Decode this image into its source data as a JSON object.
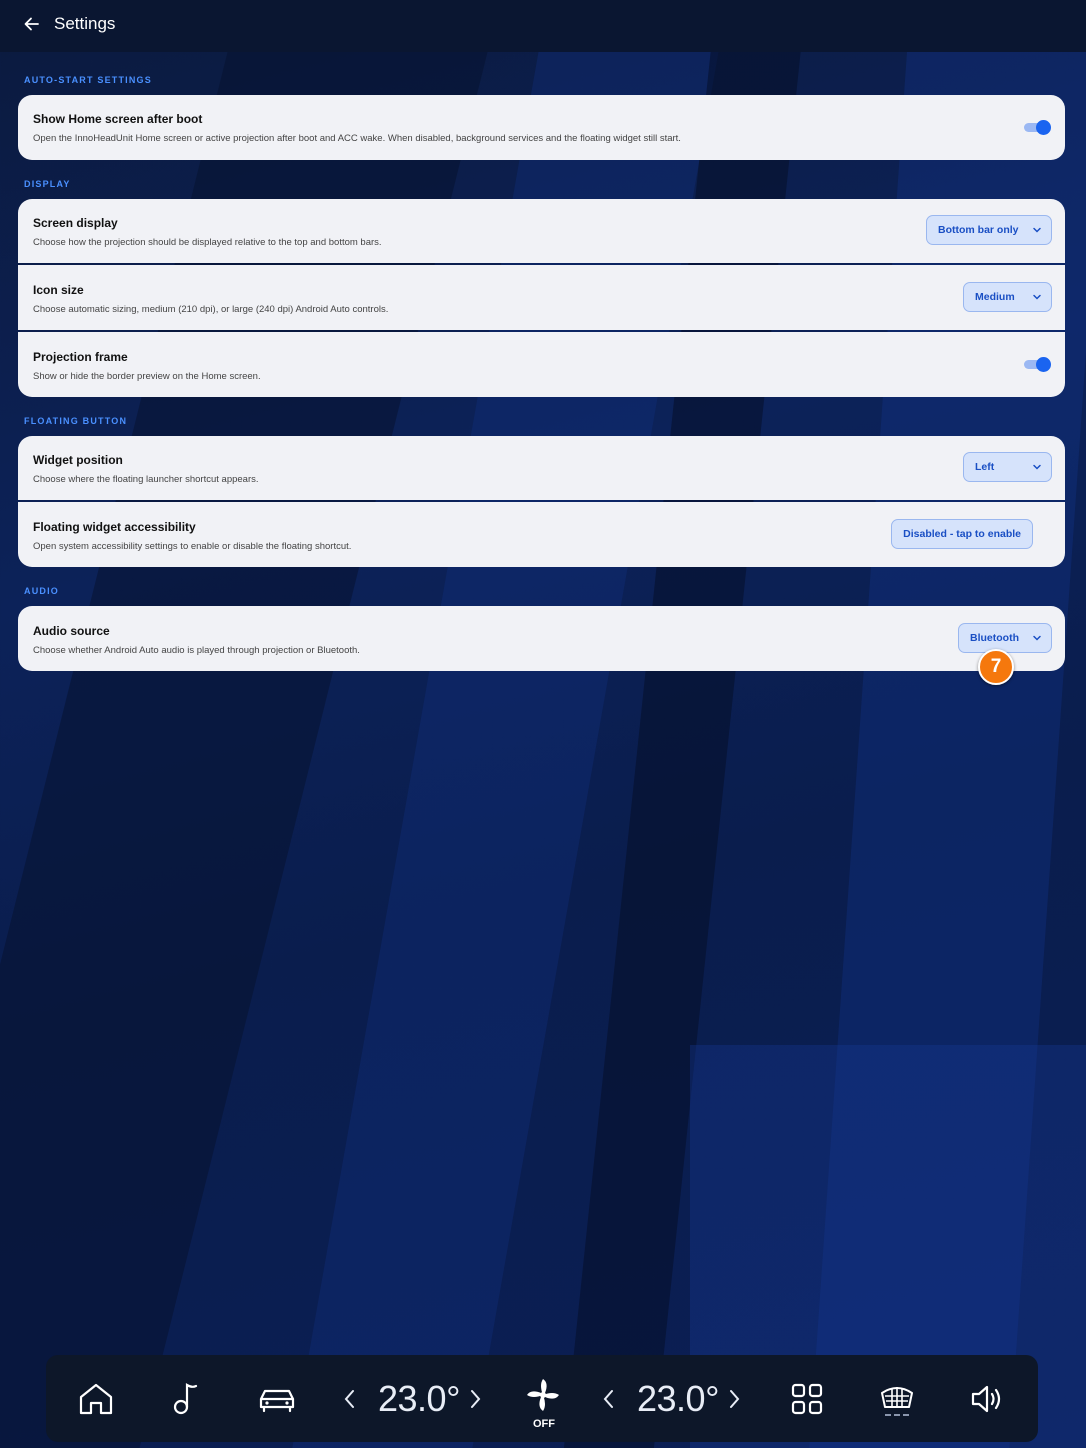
{
  "header": {
    "title": "Settings"
  },
  "sections": {
    "auto_start": {
      "title": "AUTO-START SETTINGS",
      "show_home": {
        "title": "Show Home screen after boot",
        "desc": "Open the InnoHeadUnit Home screen or active projection after boot and ACC wake. When disabled, background services and the floating widget still start.",
        "enabled": true
      }
    },
    "display": {
      "title": "DISPLAY",
      "screen_display": {
        "title": "Screen display",
        "desc": "Choose how the projection should be displayed relative to the top and bottom bars.",
        "value": "Bottom bar only"
      },
      "icon_size": {
        "title": "Icon size",
        "desc": "Choose automatic sizing, medium (210 dpi), or large (240 dpi) Android Auto controls.",
        "value": "Medium"
      },
      "projection_frame": {
        "title": "Projection frame",
        "desc": "Show or hide the border preview on the Home screen.",
        "enabled": true
      }
    },
    "floating": {
      "title": "FLOATING BUTTON",
      "widget_position": {
        "title": "Widget position",
        "desc": "Choose where the floating launcher shortcut appears.",
        "value": "Left"
      },
      "accessibility": {
        "title": "Floating widget accessibility",
        "desc": "Open system accessibility settings to enable or disable the floating shortcut.",
        "button": "Disabled - tap to enable"
      }
    },
    "audio": {
      "title": "AUDIO",
      "audio_source": {
        "title": "Audio source",
        "desc": "Choose whether Android Auto audio is played through projection or Bluetooth.",
        "value": "Bluetooth"
      }
    }
  },
  "annotation": {
    "step": "7",
    "color": "#f5780d"
  },
  "dock": {
    "left_temp": "23.0°",
    "right_temp": "23.0°",
    "fan_label": "OFF",
    "icons": [
      "home-icon",
      "music-icon",
      "car-icon",
      "chevron-left-icon",
      "chevron-right-icon",
      "fan-icon",
      "apps-grid-icon",
      "rear-defrost-icon",
      "volume-icon"
    ]
  },
  "colors": {
    "accent": "#1a64f0",
    "section_title": "#4a90ff",
    "card": "#f1f2f6",
    "chip_bg": "#d6e3fb"
  }
}
